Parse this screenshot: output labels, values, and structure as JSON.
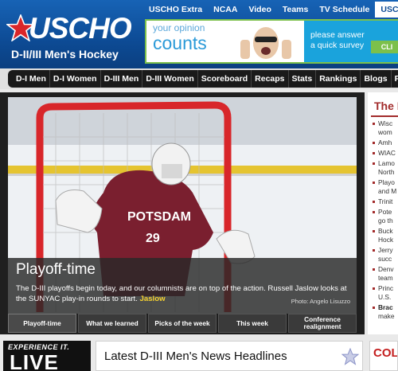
{
  "header": {
    "logo_text": "USCHO",
    "tagline": "D-II/III Men's Hockey"
  },
  "topnav": [
    {
      "label": "USCHO Extra"
    },
    {
      "label": "NCAA"
    },
    {
      "label": "Video"
    },
    {
      "label": "Teams"
    },
    {
      "label": "TV Schedule"
    },
    {
      "label": "USCHO Store"
    }
  ],
  "ad": {
    "line1": "your opinion",
    "line2": "counts",
    "message": "please answer a quick survey",
    "button": "CLI"
  },
  "mainnav": [
    {
      "label": "D-I Men"
    },
    {
      "label": "D-I Women"
    },
    {
      "label": "D-III Men"
    },
    {
      "label": "D-III Women"
    },
    {
      "label": "Scoreboard"
    },
    {
      "label": "Recaps"
    },
    {
      "label": "Stats"
    },
    {
      "label": "Rankings"
    },
    {
      "label": "Blogs"
    },
    {
      "label": "Photos"
    }
  ],
  "feature": {
    "jersey_text": "POTSDAM",
    "jersey_number": "29",
    "title": "Playoff-time",
    "text": "The D-III playoffs begin today, and our columnists are on top of the action. Russell Jaslow looks at the SUNYAC play-in rounds to start.",
    "link": "Jaslow",
    "credit": "Photo: Angelo Lisuzzo"
  },
  "tabs": [
    {
      "label": "Playoff-time"
    },
    {
      "label": "What we learned"
    },
    {
      "label": "Picks of the week"
    },
    {
      "label": "This week"
    },
    {
      "label": "Conference realignment"
    }
  ],
  "sidebar": {
    "title": "The L",
    "items": [
      {
        "line1": "Wisc",
        "line2": "wom"
      },
      {
        "line1": "Amh",
        "line2": ""
      },
      {
        "line1": "WIAC",
        "line2": ""
      },
      {
        "line1": "Lamo",
        "line2": "North"
      },
      {
        "line1": "Playo",
        "line2": "and M"
      },
      {
        "line1": "Trinit",
        "line2": ""
      },
      {
        "line1": "Pote",
        "line2": "go th"
      },
      {
        "line1": "Buck",
        "line2": "Hock"
      },
      {
        "line1": "Jerry",
        "line2": "succ"
      },
      {
        "line1": "Denv",
        "line2": "team"
      },
      {
        "line1": "Princ",
        "line2": "U.S."
      },
      {
        "line1": "Brac",
        "line2": "make"
      }
    ]
  },
  "bottom": {
    "promo_line1": "EXPERIENCE IT.",
    "promo_line2": "LIVE",
    "headlines_title": "Latest D-III Men's News Headlines",
    "right_ad_text": "COL"
  },
  "colors": {
    "header_blue": "#0d4b95",
    "nav_dark": "#1a1a1a",
    "accent_red": "#a22b2b",
    "link_yellow": "#f5d130",
    "ad_green": "#7cc04b"
  }
}
